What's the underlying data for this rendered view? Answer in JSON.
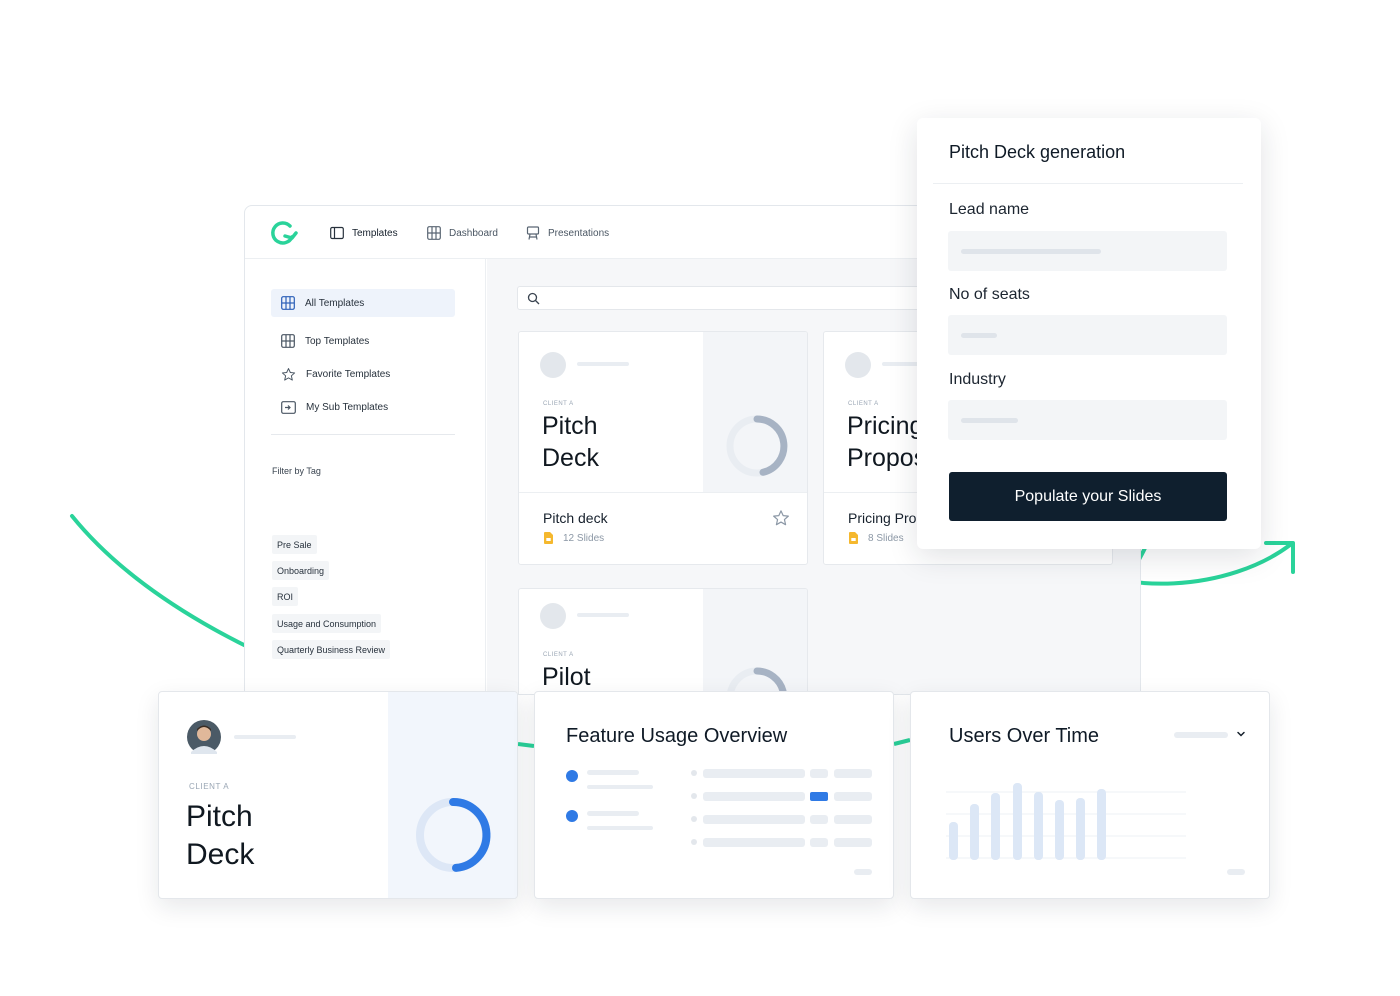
{
  "nav": {
    "templates": "Templates",
    "dashboard": "Dashboard",
    "presentations": "Presentations"
  },
  "sidebar": {
    "items": [
      {
        "label": "All Templates",
        "icon": "grid-icon",
        "active": true
      },
      {
        "label": "Top Templates",
        "icon": "grid-icon"
      },
      {
        "label": "Favorite Templates",
        "icon": "star-icon"
      },
      {
        "label": "My Sub Templates",
        "icon": "sub-template-icon"
      }
    ],
    "filter_heading": "Filter by Tag",
    "tags": [
      "Pre Sale",
      "Onboarding",
      "ROI",
      "Usage and Consumption",
      "Quarterly Business Review"
    ]
  },
  "cards": [
    {
      "client": "CLIENT A",
      "title_line1": "Pitch",
      "title_line2": "Deck",
      "name": "Pitch deck",
      "slides": "12 Slides"
    },
    {
      "client": "CLIENT A",
      "title_line1": "Pricing",
      "title_line2": "Propos",
      "name": "Pricing Pro",
      "slides": "8 Slides"
    },
    {
      "client": "CLIENT A",
      "title_line1": "Pilot",
      "title_line2": ""
    }
  ],
  "generation": {
    "title": "Pitch Deck generation",
    "lead_name_label": "Lead name",
    "seats_label": "No of seats",
    "industry_label": "Industry",
    "button": "Populate your Slides"
  },
  "bottom": {
    "pitch": {
      "client": "CLIENT A",
      "line1": "Pitch",
      "line2": "Deck"
    },
    "feature_title": "Feature Usage Overview",
    "users_title": "Users Over Time"
  },
  "colors": {
    "accent_green": "#2ad39a",
    "brand_blue": "#2f7ae5",
    "dark_navy": "#0f1f2e"
  }
}
